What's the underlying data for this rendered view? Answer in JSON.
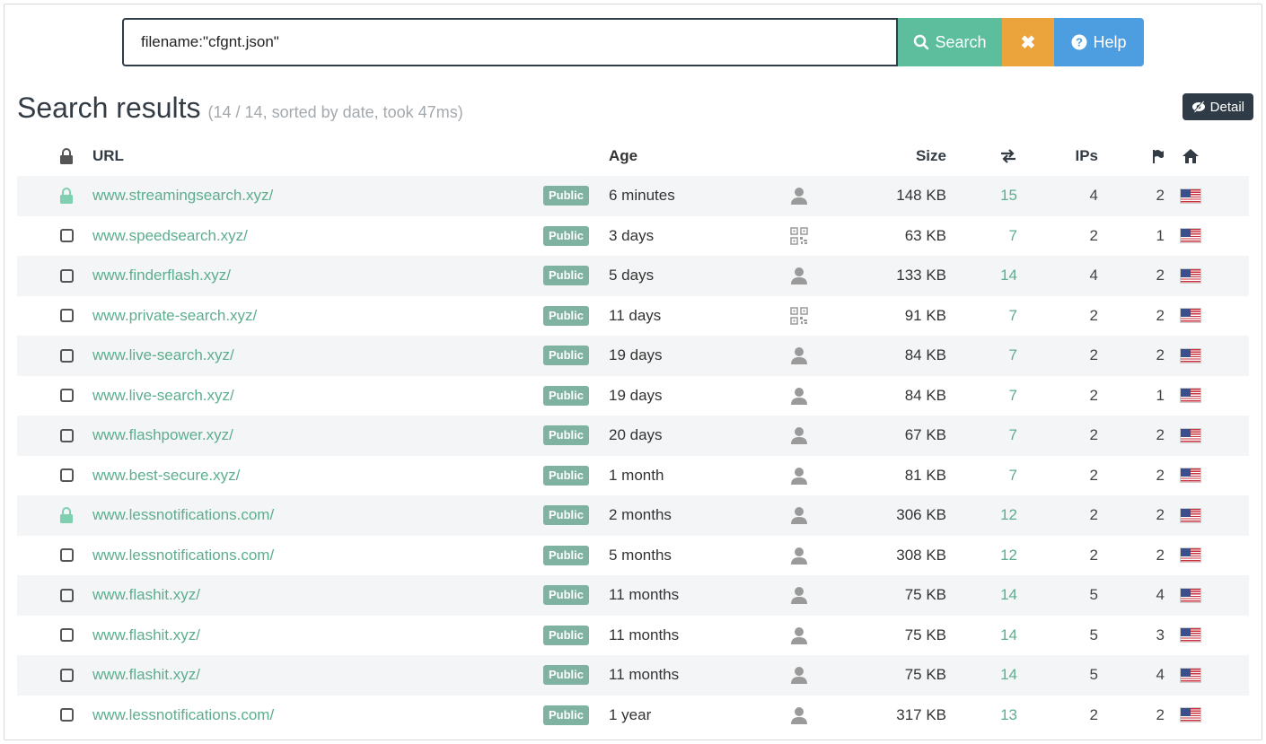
{
  "search": {
    "value": "filename:\"cfgnt.json\"",
    "search_label": "Search",
    "clear_label": "✖",
    "help_label": "Help"
  },
  "heading": {
    "title": "Search results",
    "meta": "(14 / 14, sorted by date, took 47ms)",
    "detail_label": "Detail"
  },
  "columns": {
    "url": "URL",
    "age": "Age",
    "size": "Size",
    "ips": "IPs"
  },
  "colors": {
    "accent_green": "#5cbe9d",
    "clear_orange": "#eba33b",
    "help_blue": "#4d9ee0",
    "dark": "#2f3b46"
  },
  "rows": [
    {
      "lock": "lock-icon",
      "url": "www.streamingsearch.xyz/",
      "badge": "Public",
      "age": "6 minutes",
      "agent": "user-icon",
      "size": "148 KB",
      "requests": "15",
      "ips": "4",
      "flags": "2",
      "country": "us-flag"
    },
    {
      "lock": "checkbox",
      "url": "www.speedsearch.xyz/",
      "badge": "Public",
      "age": "3 days",
      "agent": "qrcode-icon",
      "size": "63 KB",
      "requests": "7",
      "ips": "2",
      "flags": "1",
      "country": "us-flag"
    },
    {
      "lock": "checkbox",
      "url": "www.finderflash.xyz/",
      "badge": "Public",
      "age": "5 days",
      "agent": "user-icon",
      "size": "133 KB",
      "requests": "14",
      "ips": "4",
      "flags": "2",
      "country": "us-flag"
    },
    {
      "lock": "checkbox",
      "url": "www.private-search.xyz/",
      "badge": "Public",
      "age": "11 days",
      "agent": "qrcode-icon",
      "size": "91 KB",
      "requests": "7",
      "ips": "2",
      "flags": "2",
      "country": "us-flag"
    },
    {
      "lock": "checkbox",
      "url": "www.live-search.xyz/",
      "badge": "Public",
      "age": "19 days",
      "agent": "user-icon",
      "size": "84 KB",
      "requests": "7",
      "ips": "2",
      "flags": "2",
      "country": "us-flag"
    },
    {
      "lock": "checkbox",
      "url": "www.live-search.xyz/",
      "badge": "Public",
      "age": "19 days",
      "agent": "user-icon",
      "size": "84 KB",
      "requests": "7",
      "ips": "2",
      "flags": "1",
      "country": "us-flag"
    },
    {
      "lock": "checkbox",
      "url": "www.flashpower.xyz/",
      "badge": "Public",
      "age": "20 days",
      "agent": "user-icon",
      "size": "67 KB",
      "requests": "7",
      "ips": "2",
      "flags": "2",
      "country": "us-flag"
    },
    {
      "lock": "checkbox",
      "url": "www.best-secure.xyz/",
      "badge": "Public",
      "age": "1 month",
      "agent": "user-icon",
      "size": "81 KB",
      "requests": "7",
      "ips": "2",
      "flags": "2",
      "country": "us-flag"
    },
    {
      "lock": "lock-icon",
      "url": "www.lessnotifications.com/",
      "badge": "Public",
      "age": "2 months",
      "agent": "user-icon",
      "size": "306 KB",
      "requests": "12",
      "ips": "2",
      "flags": "2",
      "country": "us-flag"
    },
    {
      "lock": "checkbox",
      "url": "www.lessnotifications.com/",
      "badge": "Public",
      "age": "5 months",
      "agent": "user-icon",
      "size": "308 KB",
      "requests": "12",
      "ips": "2",
      "flags": "2",
      "country": "us-flag"
    },
    {
      "lock": "checkbox",
      "url": "www.flashit.xyz/",
      "badge": "Public",
      "age": "11 months",
      "agent": "user-icon",
      "size": "75 KB",
      "requests": "14",
      "ips": "5",
      "flags": "4",
      "country": "us-flag"
    },
    {
      "lock": "checkbox",
      "url": "www.flashit.xyz/",
      "badge": "Public",
      "age": "11 months",
      "agent": "user-icon",
      "size": "75 KB",
      "requests": "14",
      "ips": "5",
      "flags": "3",
      "country": "us-flag"
    },
    {
      "lock": "checkbox",
      "url": "www.flashit.xyz/",
      "badge": "Public",
      "age": "11 months",
      "agent": "user-icon",
      "size": "75 KB",
      "requests": "14",
      "ips": "5",
      "flags": "4",
      "country": "us-flag"
    },
    {
      "lock": "checkbox",
      "url": "www.lessnotifications.com/",
      "badge": "Public",
      "age": "1 year",
      "agent": "user-icon",
      "size": "317 KB",
      "requests": "13",
      "ips": "2",
      "flags": "2",
      "country": "us-flag"
    }
  ]
}
